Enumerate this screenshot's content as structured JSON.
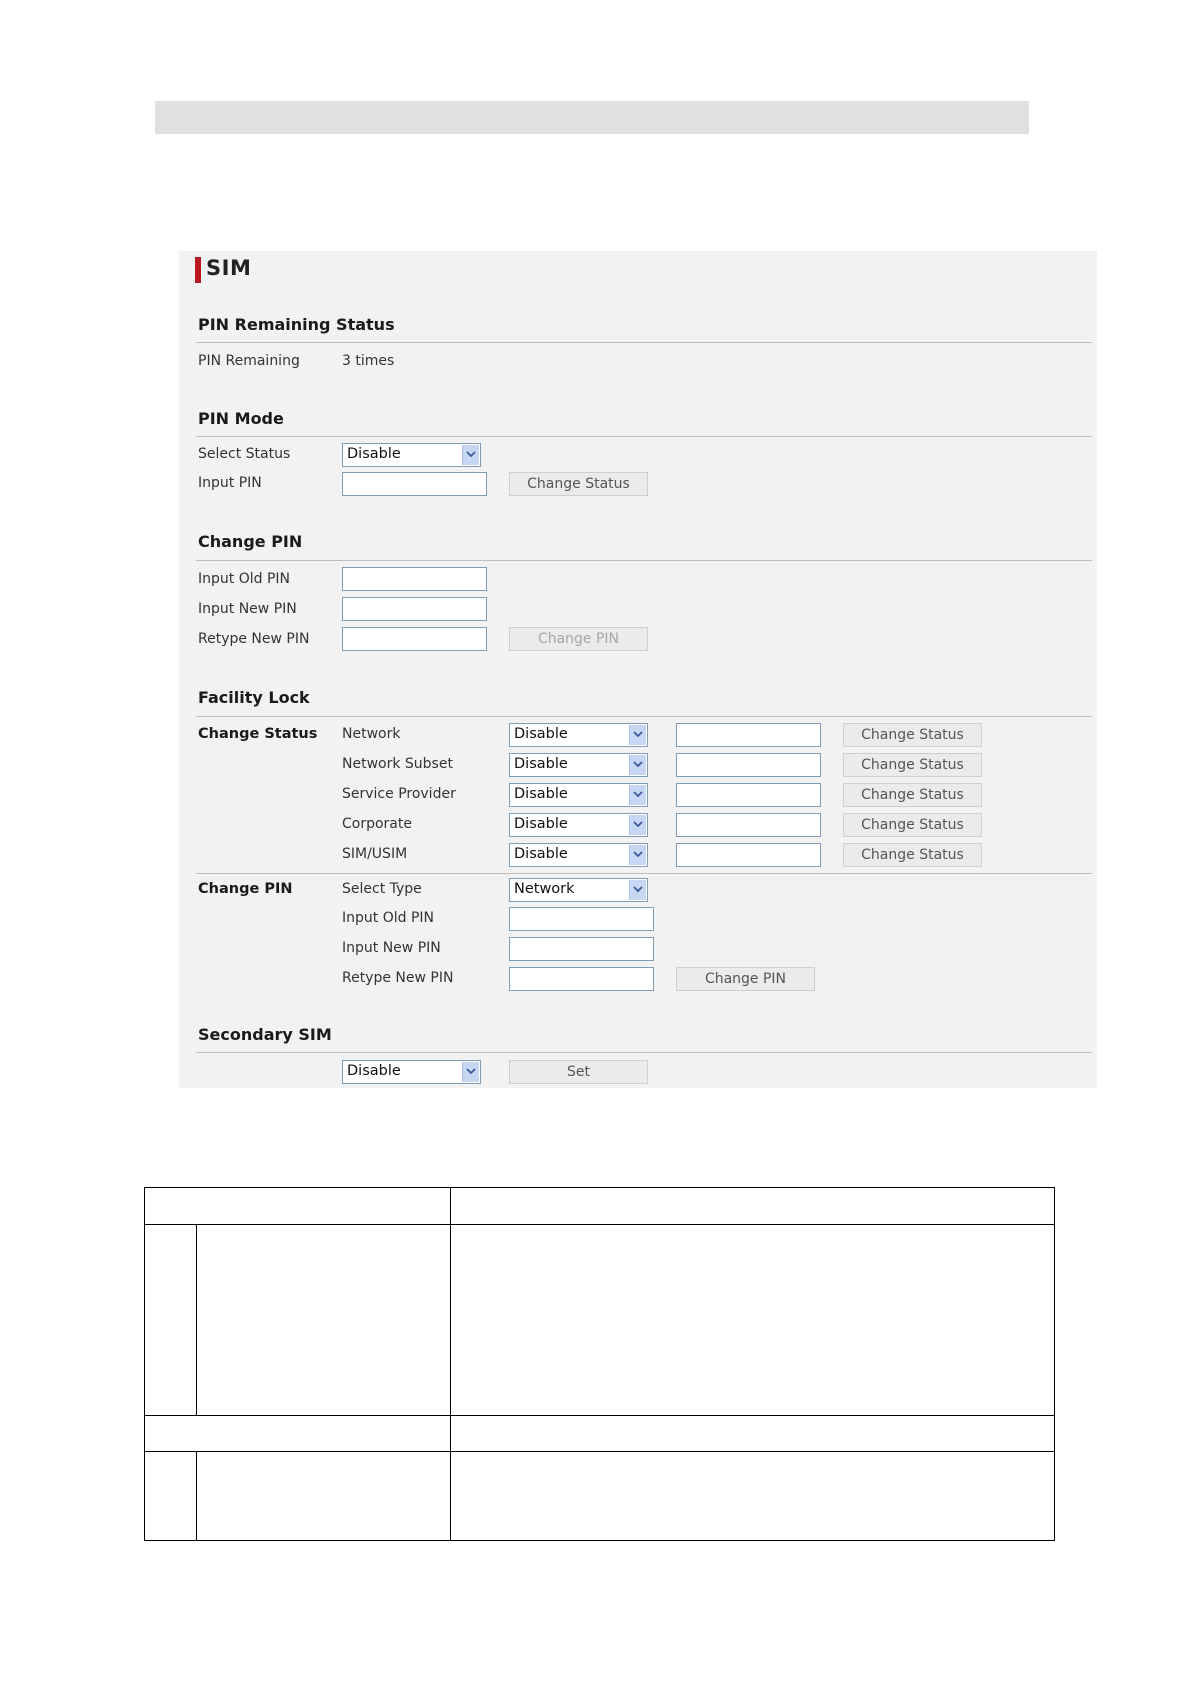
{
  "sim": {
    "title": "SIM",
    "pin_remaining_status": {
      "heading": "PIN Remaining Status",
      "pin_remaining_label": "PIN Remaining",
      "pin_remaining_value": "3 times"
    },
    "pin_mode": {
      "heading": "PIN Mode",
      "select_status_label": "Select Status",
      "select_status_value": "Disable",
      "input_pin_label": "Input PIN",
      "change_status_button": "Change Status"
    },
    "change_pin": {
      "heading": "Change PIN",
      "old_pin_label": "Input Old PIN",
      "new_pin_label": "Input New PIN",
      "retype_pin_label": "Retype New PIN",
      "change_pin_button": "Change PIN"
    },
    "facility_lock": {
      "heading": "Facility Lock",
      "change_status_label": "Change Status",
      "button_label": "Change Status",
      "rows": [
        {
          "name": "Network",
          "value": "Disable"
        },
        {
          "name": "Network Subset",
          "value": "Disable"
        },
        {
          "name": "Service Provider",
          "value": "Disable"
        },
        {
          "name": "Corporate",
          "value": "Disable"
        },
        {
          "name": "SIM/USIM",
          "value": "Disable"
        }
      ],
      "change_pin_label": "Change PIN",
      "select_type_label": "Select Type",
      "select_type_value": "Network",
      "old_pin_label": "Input Old PIN",
      "new_pin_label": "Input New PIN",
      "retype_pin_label": "Retype New PIN",
      "change_pin_button": "Change PIN"
    },
    "secondary_sim": {
      "heading": "Secondary SIM",
      "select_value": "Disable",
      "set_button": "Set"
    }
  },
  "colors": {
    "accent": "#b8191f",
    "panel_bg": "#f2f2f2",
    "header_bar": "#e0e0e0",
    "select_arrow_bg": "#c7d6f2"
  }
}
